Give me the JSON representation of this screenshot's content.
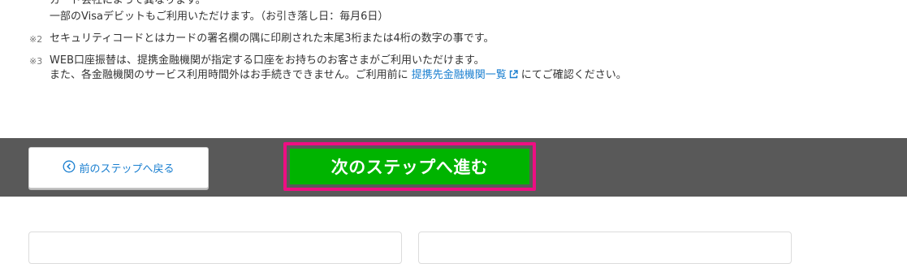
{
  "notes": {
    "line1_cut": "カード会社によって異なります。",
    "line2": "一部のVisaデビットもご利用いただけます。（お引き落し日：毎月6日）",
    "note2": {
      "mark": "※2",
      "text": "セキュリティコードとはカードの署名欄の隅に印刷された末尾3桁または4桁の数字の事です。"
    },
    "note3": {
      "mark": "※3",
      "text_line1": "WEB口座振替は、提携金融機関が指定する口座をお持ちのお客さまがご利用いただけます。",
      "text_line2_before": "また、各金融機関のサービス利用時間外はお手続きできません。ご利用前に",
      "link": "提携先金融機関一覧",
      "text_line2_after": "にてご確認ください。"
    }
  },
  "footer": {
    "back_label": "前のステップへ戻る",
    "next_label": "次のステップへ進む"
  },
  "colors": {
    "footer_bg": "#595959",
    "next_bg": "#00b400",
    "highlight": "#ee0e83",
    "link": "#1a7fd0"
  }
}
